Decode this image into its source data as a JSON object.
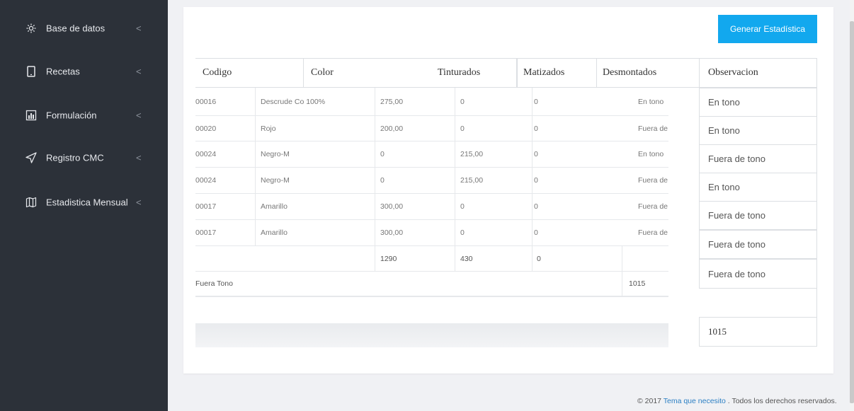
{
  "sidebar": {
    "items": [
      {
        "label": "Base de datos",
        "icon": "gear-icon"
      },
      {
        "label": "Recetas",
        "icon": "tablet-icon"
      },
      {
        "label": "Formulación",
        "icon": "bar-chart-icon"
      },
      {
        "label": "Registro CMC",
        "icon": "send-icon"
      },
      {
        "label": "Estadistica Mensual",
        "icon": "map-icon"
      }
    ],
    "chevron": "<"
  },
  "toolbar": {
    "generate_label": "Generar Estadística"
  },
  "table": {
    "headers": [
      "Codigo",
      "Color",
      "Tinturados",
      "Matizados",
      "Desmontados",
      "Observacion"
    ],
    "inner_rows": [
      {
        "codigo": "00016",
        "color": "Descrude Co 100%",
        "v1": "275,00",
        "v2": "0",
        "v3": "0",
        "estado": "En tono"
      },
      {
        "codigo": "00020",
        "color": "Rojo",
        "v1": "200,00",
        "v2": "0",
        "v3": "0",
        "estado": "Fuera de"
      },
      {
        "codigo": "00024",
        "color": "Negro-M",
        "v1": "0",
        "v2": "215,00",
        "v3": "0",
        "estado": "En tono"
      },
      {
        "codigo": "00024",
        "color": "Negro-M",
        "v1": "0",
        "v2": "215,00",
        "v3": "0",
        "estado": "Fuera de"
      },
      {
        "codigo": "00017",
        "color": "Amarillo",
        "v1": "300,00",
        "v2": "0",
        "v3": "0",
        "estado": "Fuera de"
      },
      {
        "codigo": "00017",
        "color": "Amarillo",
        "v1": "300,00",
        "v2": "0",
        "v3": "0",
        "estado": "Fuera de"
      }
    ],
    "totals": {
      "v1": "1290",
      "v2": "430",
      "v3": "0"
    },
    "fuera_tono": {
      "label": "Fuera Tono",
      "value": "1015"
    },
    "observaciones": [
      "En tono",
      "En tono",
      "Fuera de tono",
      "En tono",
      "Fuera de tono",
      "Fuera de tono",
      "Fuera de tono",
      "",
      "1015"
    ]
  },
  "footer": {
    "prefix": "© 2017 ",
    "link": "Tema que necesito",
    "suffix": " . Todos los derechos reservados."
  }
}
